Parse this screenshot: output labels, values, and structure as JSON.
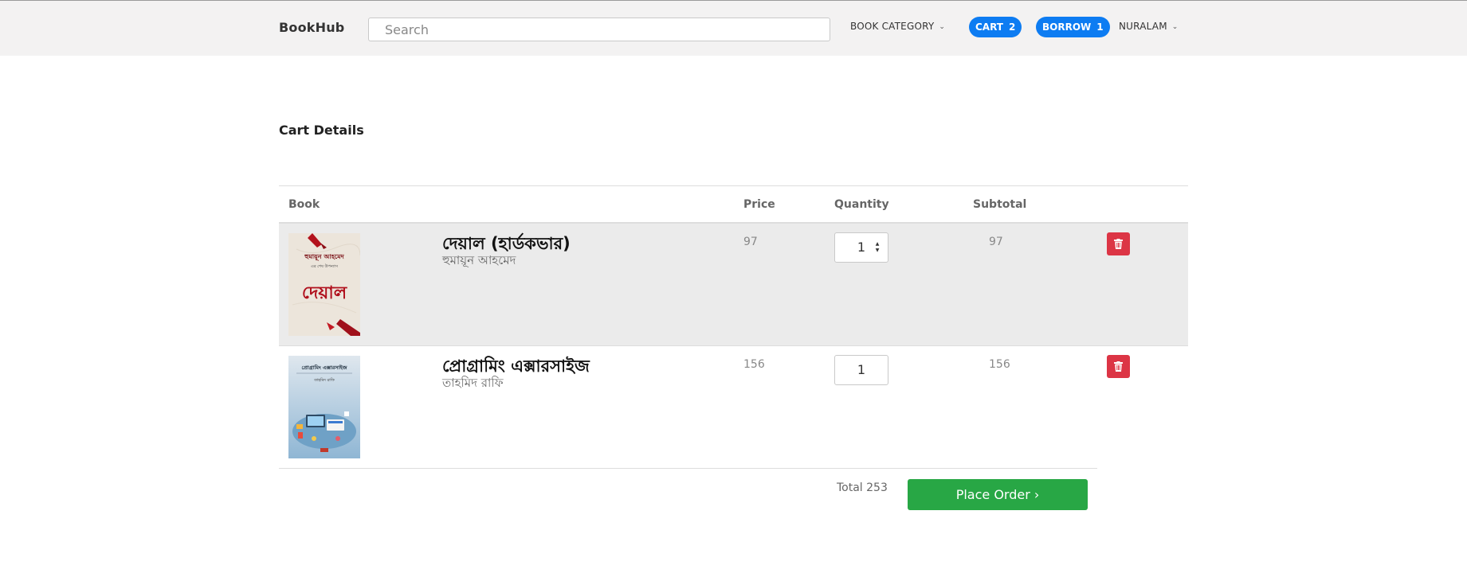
{
  "header": {
    "brand": "BookHub",
    "search_placeholder": "Search",
    "book_category_label": "BOOK CATEGORY",
    "cart_label": "CART",
    "cart_count": "2",
    "borrow_label": "BORROW",
    "borrow_count": "1",
    "user_label": "NURALAM"
  },
  "page_title": "Cart Details",
  "table": {
    "columns": [
      "Book",
      "Price",
      "Quantity",
      "Subtotal"
    ],
    "rows": [
      {
        "title": "দেয়াল (হার্ডকভার)",
        "author": "হুমায়ূন আহমেদ",
        "price": "97",
        "quantity": "1",
        "subtotal": "97",
        "cover": {
          "top_line": "হুমায়ূন আহমেদ",
          "sub_line": "এর শেষ উপন্যাস",
          "big_text": "দেয়াল"
        }
      },
      {
        "title": "প্রোগ্রামিং এক্সারসাইজ",
        "author": "তাহমিদ রাফি",
        "price": "156",
        "quantity": "1",
        "subtotal": "156",
        "cover": {
          "top_line": "প্রোগ্রামিং এক্সারসাইজ",
          "sub_line": "তাহমিদ রাফি"
        }
      }
    ]
  },
  "total_label": "Total 253",
  "place_order_label": "Place Order ›",
  "colors": {
    "primary": "#0d7cf2",
    "danger": "#dc3545",
    "success": "#28a745",
    "header_bg": "#f3f2f2",
    "row_shade": "#ebebeb"
  }
}
